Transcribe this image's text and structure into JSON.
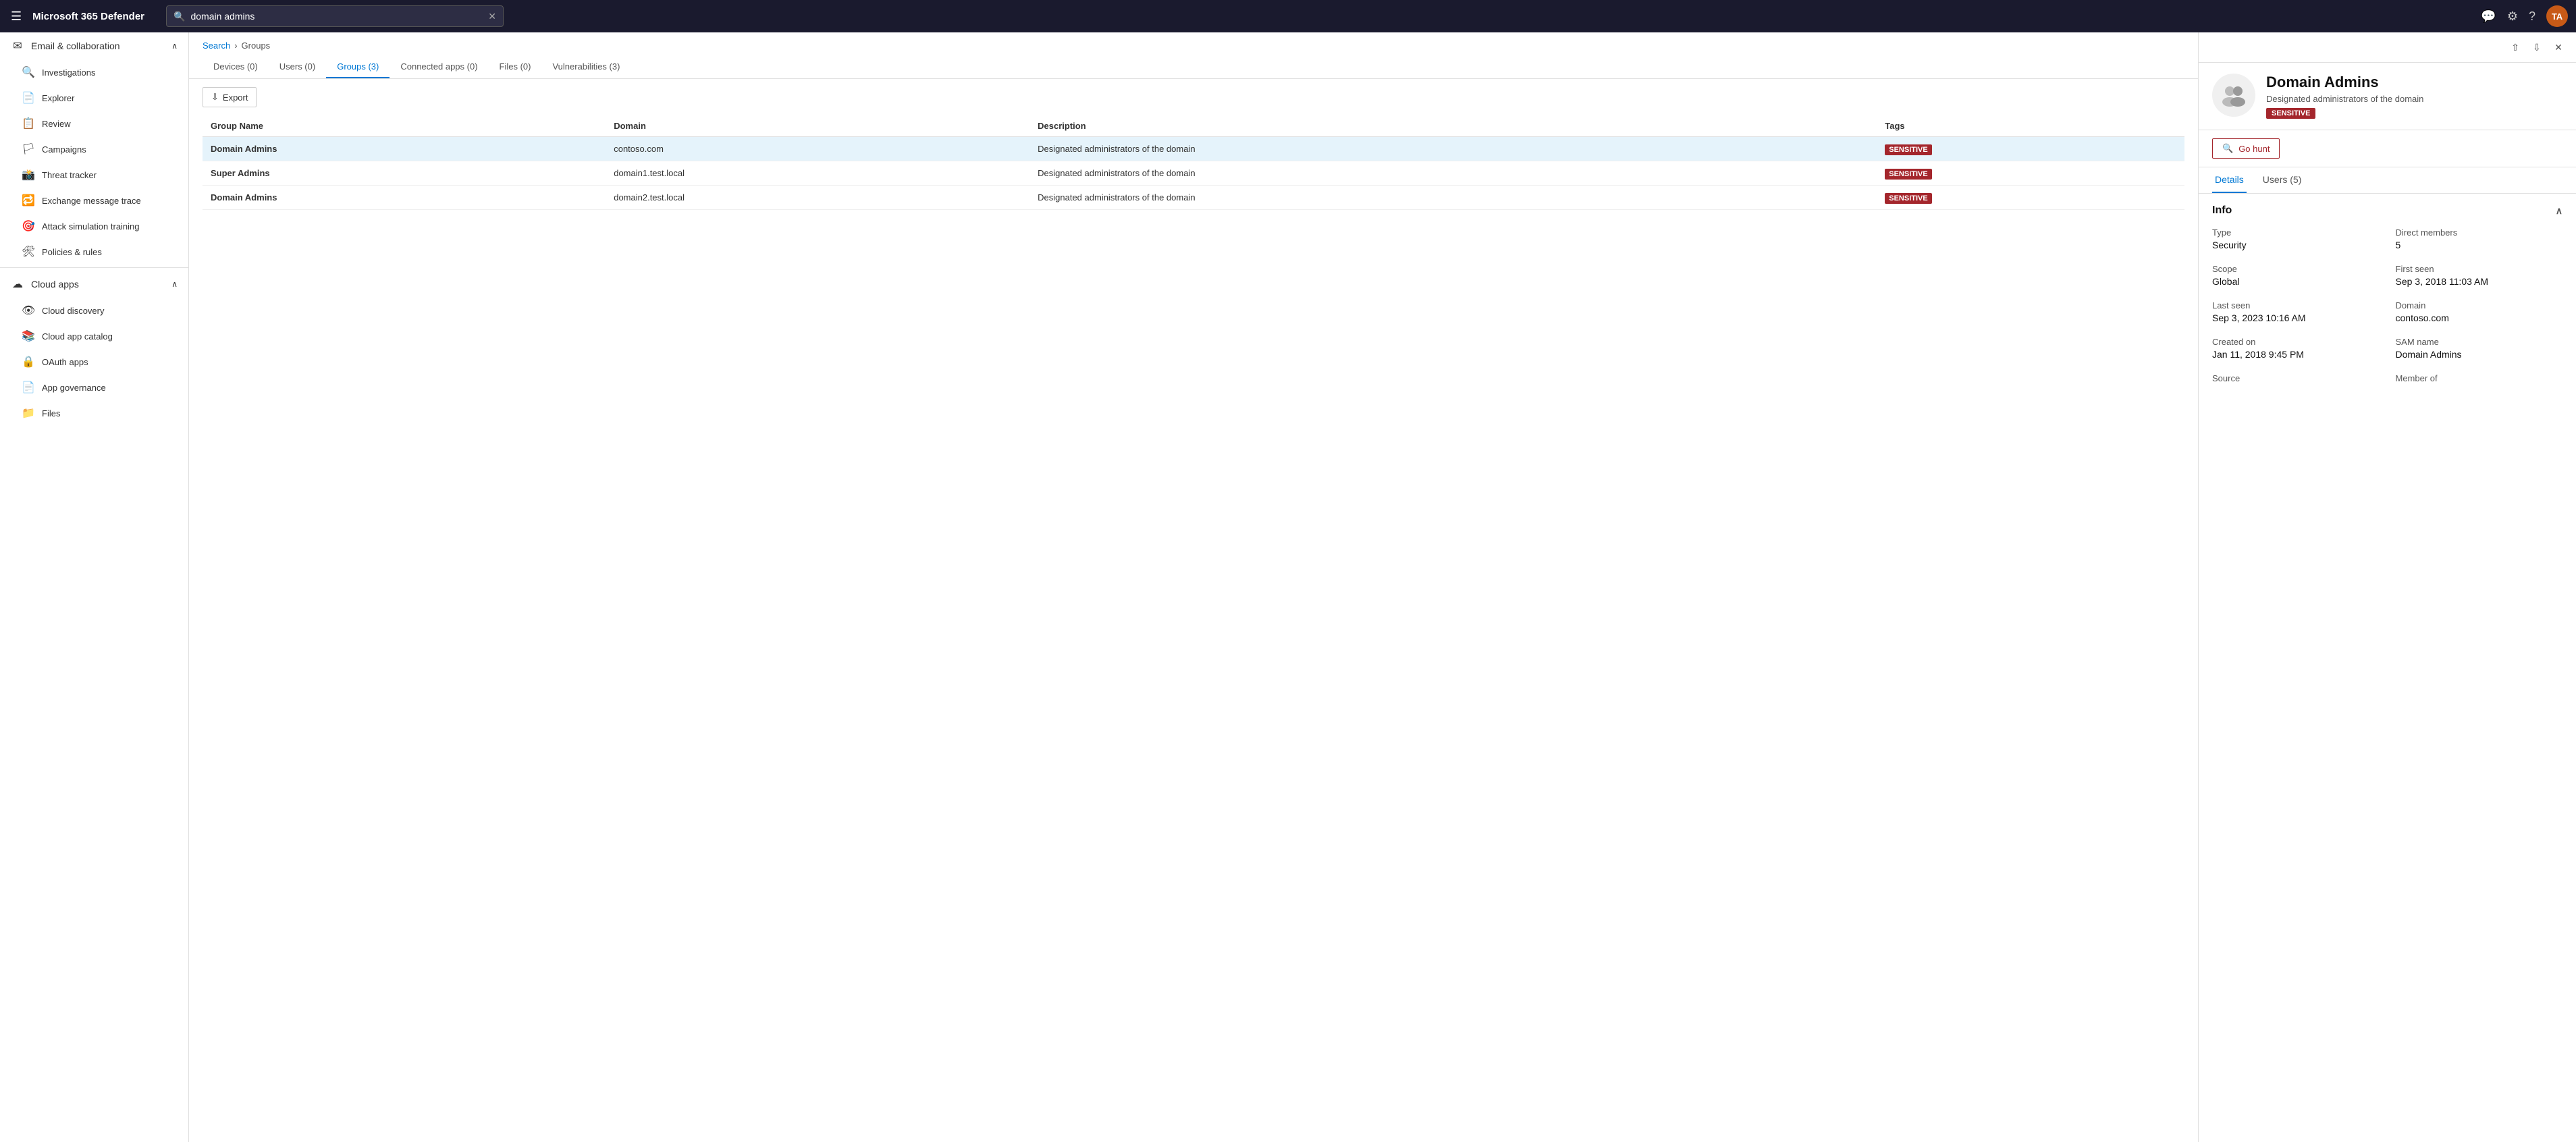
{
  "app": {
    "title": "Microsoft 365 Defender"
  },
  "topbar": {
    "search_placeholder": "domain admins",
    "search_value": "domain admins",
    "avatar_initials": "TA"
  },
  "sidebar": {
    "email_collab_label": "Email & collaboration",
    "investigations_label": "Investigations",
    "explorer_label": "Explorer",
    "review_label": "Review",
    "campaigns_label": "Campaigns",
    "threat_tracker_label": "Threat tracker",
    "exchange_message_trace_label": "Exchange message trace",
    "attack_simulation_label": "Attack simulation training",
    "policies_rules_label": "Policies & rules",
    "cloud_apps_label": "Cloud apps",
    "cloud_discovery_label": "Cloud discovery",
    "cloud_app_catalog_label": "Cloud app catalog",
    "oauth_apps_label": "OAuth apps",
    "app_governance_label": "App governance",
    "files_label": "Files"
  },
  "breadcrumb": {
    "search_label": "Search",
    "separator": "›",
    "groups_label": "Groups"
  },
  "tabs": [
    {
      "label": "Devices (0)",
      "count": 0,
      "id": "devices"
    },
    {
      "label": "Users (0)",
      "count": 0,
      "id": "users"
    },
    {
      "label": "Groups (3)",
      "count": 3,
      "id": "groups",
      "active": true
    },
    {
      "label": "Connected apps (0)",
      "count": 0,
      "id": "connected_apps"
    },
    {
      "label": "Files (0)",
      "count": 0,
      "id": "files"
    },
    {
      "label": "Vulnerabilities (3)",
      "count": 3,
      "id": "vulnerabilities"
    }
  ],
  "toolbar": {
    "export_label": "Export"
  },
  "table": {
    "columns": [
      {
        "label": "Group Name",
        "id": "group_name"
      },
      {
        "label": "Domain",
        "id": "domain"
      },
      {
        "label": "Description",
        "id": "description"
      },
      {
        "label": "Tags",
        "id": "tags"
      }
    ],
    "rows": [
      {
        "group_name": "Domain Admins",
        "domain": "contoso.com",
        "description": "Designated administrators of the domain",
        "tag": "SENSITIVE",
        "selected": true
      },
      {
        "group_name": "Super Admins",
        "domain": "domain1.test.local",
        "description": "Designated administrators of the domain",
        "tag": "SENSITIVE",
        "selected": false
      },
      {
        "group_name": "Domain Admins",
        "domain": "domain2.test.local",
        "description": "Designated administrators of the domain",
        "tag": "SENSITIVE",
        "selected": false
      }
    ]
  },
  "detail": {
    "title": "Domain Admins",
    "subtitle": "Designated administrators of the domain",
    "badge": "SENSITIVE",
    "go_hunt_label": "Go hunt",
    "tabs": [
      {
        "label": "Details",
        "active": true
      },
      {
        "label": "Users (5)",
        "active": false
      }
    ],
    "info_section_label": "Info",
    "fields": {
      "type_label": "Type",
      "type_value": "Security",
      "direct_members_label": "Direct members",
      "direct_members_value": "5",
      "scope_label": "Scope",
      "scope_value": "Global",
      "first_seen_label": "First seen",
      "first_seen_value": "Sep 3, 2018 11:03 AM",
      "last_seen_label": "Last seen",
      "last_seen_value": "Sep 3, 2023 10:16 AM",
      "domain_label": "Domain",
      "domain_value": "contoso.com",
      "created_on_label": "Created on",
      "created_on_value": "Jan 11, 2018 9:45 PM",
      "sam_name_label": "SAM name",
      "sam_name_value": "Domain Admins",
      "source_label": "Source",
      "member_of_label": "Member of"
    }
  }
}
